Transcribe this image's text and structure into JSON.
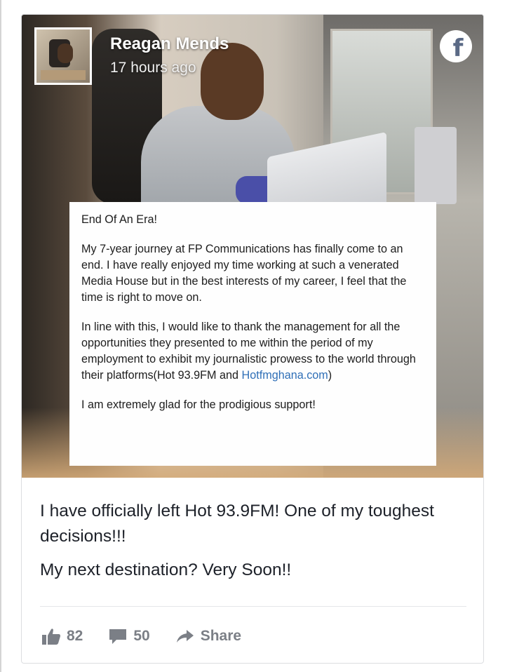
{
  "post": {
    "author": "Reagan Mends",
    "time": "17 hours ago",
    "letter": {
      "title": "End Of An Era!",
      "para1": "My 7-year journey at FP Communications has finally come to an end. I have really enjoyed my time working at such a venerated Media House but in the best interests of my career, I feel that the time is right to move on.",
      "para2_before": "In line with this, I would like to thank the management for all the opportunities they presented to me within the period of my employment to exhibit my journalistic prowess to the world through their platforms(Hot 93.9FM and ",
      "para2_link": "Hotfmghana.com",
      "para2_after": ")",
      "para3": "I am extremely glad  for the prodigious support!"
    },
    "text1": "I have officially left Hot 93.9FM! One of my toughest decisions!!!",
    "text2": "My next destination? Very Soon!!"
  },
  "actions": {
    "likes": "82",
    "comments": "50",
    "share": "Share"
  },
  "icons": {
    "brand": "facebook-icon",
    "like": "thumbs-up-icon",
    "comment": "comment-bubble-icon",
    "share": "share-arrow-icon"
  },
  "colors": {
    "link": "#2f6fb7",
    "action_gray": "#7b7f86"
  }
}
